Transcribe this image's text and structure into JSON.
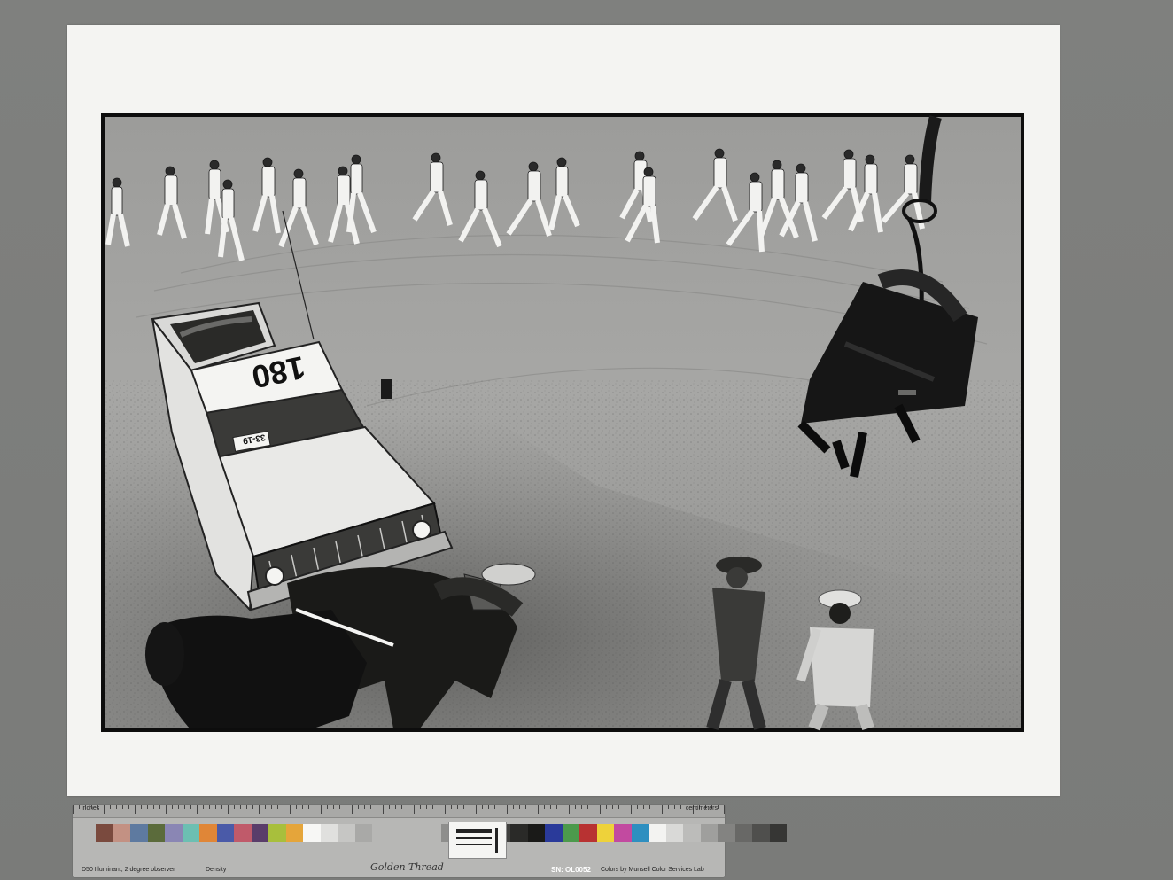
{
  "photo": {
    "car_number": "180",
    "car_plate": "33-19"
  },
  "checker": {
    "ruler_left_label": "inches",
    "ruler_right_label": "centimeters",
    "illuminant": "D50 Illuminant, 2 degree observer",
    "density_label": "Density",
    "brand": "Golden Thread",
    "serial": "SN: OL0052",
    "credit": "Colors by Munsell Color Services Lab",
    "swatch_colors": [
      "#7a4a3e",
      "#c39183",
      "#5e7aa0",
      "#5b6b3b",
      "#8a86b4",
      "#6cbfb2",
      "#e08637",
      "#4a5aa8",
      "#c05a6a",
      "#5a3d6a",
      "#a8bf3c",
      "#e5a53a",
      "#f7f7f5",
      "#e0e0de",
      "#c6c6c4",
      "#a9a9a7",
      "#8e8e8c",
      "#737371",
      "#5a5a58",
      "#3f3f3d",
      "#2a2a28",
      "#1a1a18",
      "#2a3a9a",
      "#4c9a4c",
      "#b83232",
      "#eed23a",
      "#c24aa0",
      "#2e8fc0",
      "#f3f3f1",
      "#d9d9d7",
      "#bcbcba",
      "#9f9f9d",
      "#838381",
      "#686866",
      "#4f4f4d",
      "#363634"
    ]
  }
}
